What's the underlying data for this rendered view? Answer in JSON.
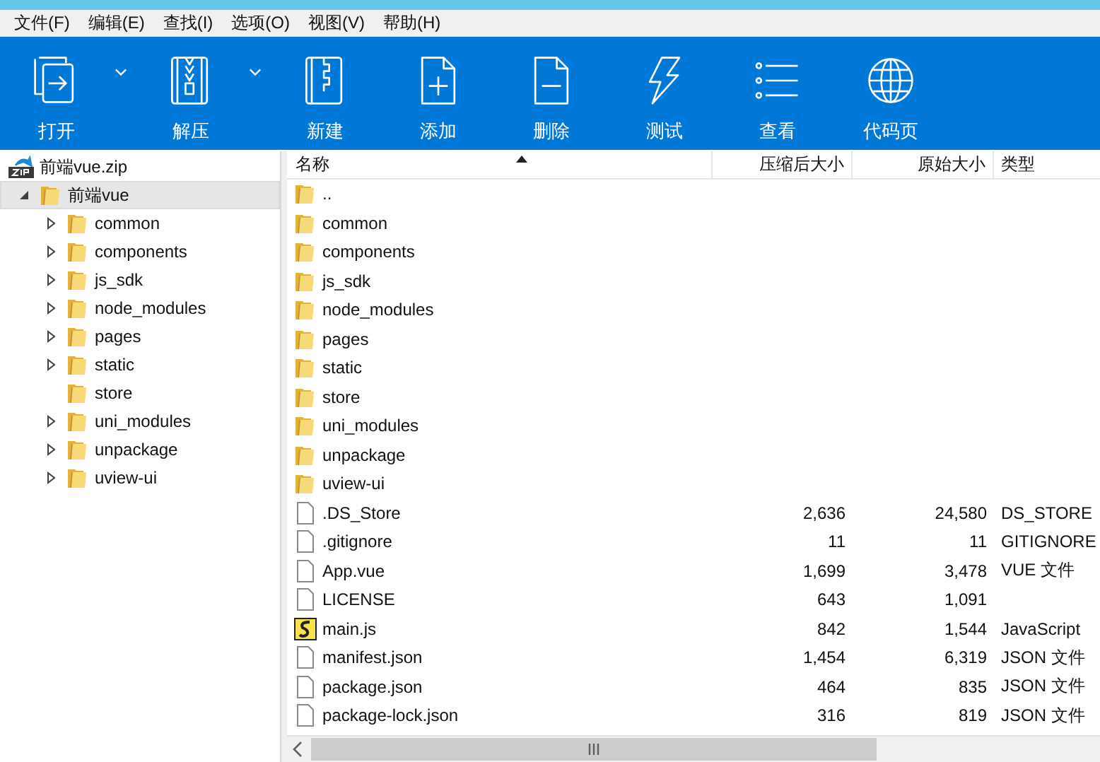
{
  "menu": [
    "文件(F)",
    "编辑(E)",
    "查找(I)",
    "选项(O)",
    "视图(V)",
    "帮助(H)"
  ],
  "toolbar": [
    {
      "label": "打开",
      "kind": "open",
      "dropdown": true
    },
    {
      "label": "解压",
      "kind": "extract",
      "dropdown": true
    },
    {
      "label": "新建",
      "kind": "new",
      "dropdown": false
    },
    {
      "label": "添加",
      "kind": "add",
      "dropdown": false
    },
    {
      "label": "删除",
      "kind": "delete",
      "dropdown": false
    },
    {
      "label": "测试",
      "kind": "test",
      "dropdown": false
    },
    {
      "label": "查看",
      "kind": "view",
      "dropdown": false
    },
    {
      "label": "代码页",
      "kind": "codepage",
      "dropdown": false
    }
  ],
  "tree": [
    {
      "label": "前端vue.zip",
      "kind": "archive",
      "selected": false,
      "expander": false,
      "expanded": true,
      "children": [
        {
          "label": "前端vue",
          "kind": "folder",
          "selected": true,
          "expander": true,
          "expanded": true,
          "children": [
            {
              "label": "common",
              "kind": "folder",
              "selected": false,
              "expander": true,
              "expanded": false
            },
            {
              "label": "components",
              "kind": "folder",
              "selected": false,
              "expander": true,
              "expanded": false
            },
            {
              "label": "js_sdk",
              "kind": "folder",
              "selected": false,
              "expander": true,
              "expanded": false
            },
            {
              "label": "node_modules",
              "kind": "folder",
              "selected": false,
              "expander": true,
              "expanded": false
            },
            {
              "label": "pages",
              "kind": "folder",
              "selected": false,
              "expander": true,
              "expanded": false
            },
            {
              "label": "static",
              "kind": "folder",
              "selected": false,
              "expander": true,
              "expanded": false
            },
            {
              "label": "store",
              "kind": "folder",
              "selected": false,
              "expander": false,
              "expanded": false
            },
            {
              "label": "uni_modules",
              "kind": "folder",
              "selected": false,
              "expander": true,
              "expanded": false
            },
            {
              "label": "unpackage",
              "kind": "folder",
              "selected": false,
              "expander": true,
              "expanded": false
            },
            {
              "label": "uview-ui",
              "kind": "folder",
              "selected": false,
              "expander": true,
              "expanded": false
            }
          ]
        }
      ]
    }
  ],
  "table": {
    "columns": [
      "名称",
      "压缩后大小",
      "原始大小",
      "类型"
    ],
    "rows": [
      {
        "kind": "folder",
        "name": ".."
      },
      {
        "kind": "folder",
        "name": "common"
      },
      {
        "kind": "folder",
        "name": "components"
      },
      {
        "kind": "folder",
        "name": "js_sdk"
      },
      {
        "kind": "folder",
        "name": "node_modules"
      },
      {
        "kind": "folder",
        "name": "pages"
      },
      {
        "kind": "folder",
        "name": "static"
      },
      {
        "kind": "folder",
        "name": "store"
      },
      {
        "kind": "folder",
        "name": "uni_modules"
      },
      {
        "kind": "folder",
        "name": "unpackage"
      },
      {
        "kind": "folder",
        "name": "uview-ui"
      },
      {
        "kind": "file",
        "name": ".DS_Store",
        "packed": "2,636",
        "size": "24,580",
        "type": "DS_STORE"
      },
      {
        "kind": "file",
        "name": ".gitignore",
        "packed": "11",
        "size": "11",
        "type": "GITIGNORE"
      },
      {
        "kind": "file",
        "name": "App.vue",
        "packed": "1,699",
        "size": "3,478",
        "type": "VUE 文件"
      },
      {
        "kind": "file",
        "name": "LICENSE",
        "packed": "643",
        "size": "1,091"
      },
      {
        "kind": "script",
        "name": "main.js",
        "packed": "842",
        "size": "1,544",
        "type": "JavaScript"
      },
      {
        "kind": "file",
        "name": "manifest.json",
        "packed": "1,454",
        "size": "6,319",
        "type": "JSON 文件"
      },
      {
        "kind": "file",
        "name": "package.json",
        "packed": "464",
        "size": "835",
        "type": "JSON 文件"
      },
      {
        "kind": "file",
        "name": "package-lock.json",
        "packed": "316",
        "size": "819",
        "type": "JSON 文件"
      }
    ]
  }
}
